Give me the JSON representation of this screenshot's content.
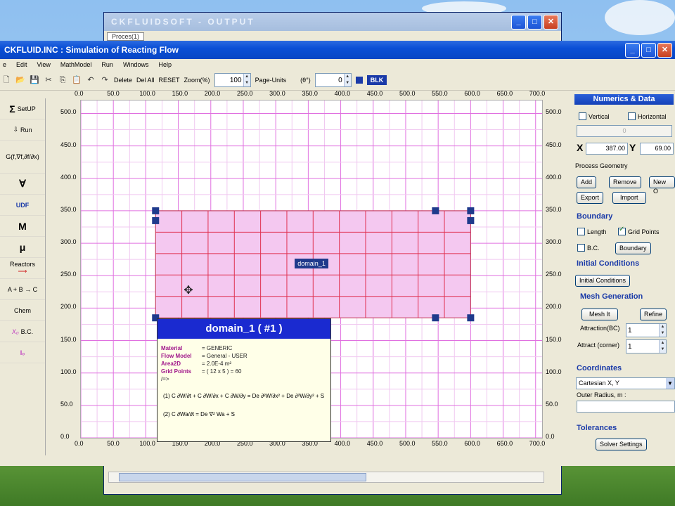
{
  "output_window": {
    "title": "CKFLUIDSOFT - OUTPUT",
    "tab": "Proces(1)"
  },
  "main_window": {
    "title": "CKFLUID.INC : Simulation of Reacting Flow"
  },
  "menu": [
    "e",
    "Edit",
    "View",
    "MathModel",
    "Run",
    "Windows",
    "Help"
  ],
  "toolbar": {
    "delete": "Delete",
    "del_all": "Del All",
    "reset": "RESET",
    "zoom_label": "Zoom(%)",
    "zoom_value": "100",
    "page_units": "Page-Units",
    "theta_label": "(θ°)",
    "theta_value": "0",
    "blk": "BLK"
  },
  "left_bar": [
    {
      "icon": "Σ",
      "label": "SetUP"
    },
    {
      "icon": "⇩",
      "label": "Run"
    },
    {
      "icon": "G(f,∇f,∂f/∂x)",
      "label": ""
    },
    {
      "icon": "∀",
      "label": ""
    },
    {
      "icon": "",
      "label": "UDF"
    },
    {
      "icon": "M",
      "label": ""
    },
    {
      "icon": "μ",
      "label": ""
    },
    {
      "icon": "",
      "label": "Reactors"
    },
    {
      "icon": "",
      "label": "A + B → C"
    },
    {
      "icon": "",
      "label": "Chem"
    },
    {
      "icon": "X₀",
      "label": "B.C."
    },
    {
      "icon": "I₀",
      "label": ""
    }
  ],
  "axes": {
    "x_ticks": [
      "0.0",
      "50.0",
      "100.0",
      "150.0",
      "200.0",
      "250.0",
      "300.0",
      "350.0",
      "400.0",
      "450.0",
      "500.0",
      "550.0",
      "600.0",
      "650.0",
      "700.0"
    ],
    "y_ticks": [
      "500.0",
      "450.0",
      "400.0",
      "350.0",
      "300.0",
      "250.0",
      "200.0",
      "150.0",
      "100.0",
      "50.0",
      "0.0"
    ]
  },
  "domain": {
    "label": "domain_1",
    "x_range": [
      115,
      600
    ],
    "y_range": [
      185,
      350
    ]
  },
  "info": {
    "title": "domain_1 ( #1 )",
    "rows": [
      {
        "k": "Material",
        "v": "= GENERIC"
      },
      {
        "k": "Flow Model",
        "v": "= General - USER"
      },
      {
        "k": "Area2D",
        "v": "= 2.0E-4 m²"
      },
      {
        "k": "Grid Points",
        "v": "= ( 12 x 5 ) = 60"
      },
      {
        "k": "/=>",
        "v": ""
      }
    ],
    "eq1": "(1) C ∂W/∂t + C ∂W/∂x + C ∂W/∂y = De ∂²W/∂x² + De ∂²W/∂y² + S",
    "eq2": "(2) C ∂Wa/∂t = De ∇² Wa + S"
  },
  "right_panel": {
    "header": "Numerics & Data",
    "vertical": "Vertical",
    "horizontal": "Horizontal",
    "angle_value": "0",
    "x_label": "X",
    "x_value": "387.00",
    "y_label": "Y",
    "y_value": "69.00",
    "process_geometry": "Process Geometry",
    "add": "Add",
    "remove": "Remove",
    "new": "New O",
    "export": "Export",
    "import": "Import",
    "boundary": "Boundary",
    "length": "Length",
    "grid_points": "Grid Points",
    "bc": "B.C.",
    "boundary_btn": "Boundary",
    "initial_conditions": "Initial Conditions",
    "initial_btn": "Initial Conditions",
    "mesh_generation": "Mesh Generation",
    "mesh_it": "Mesh It",
    "refine": "Refine",
    "attraction_bc": "Attraction(BC)",
    "attraction_bc_val": "1",
    "attract_corner": "Attract (corner)",
    "attract_corner_val": "1",
    "coordinates": "Coordinates",
    "coord_value": "Cartesian X, Y",
    "outer_radius": "Outer Radius, m :",
    "tolerances": "Tolerances",
    "solver_settings": "Solver Settings"
  },
  "colors": {
    "grid_major": "#e070e0",
    "domain_fill": "#f4c8f0",
    "domain_grid": "#e03050",
    "accent": "#1a3aa8"
  }
}
